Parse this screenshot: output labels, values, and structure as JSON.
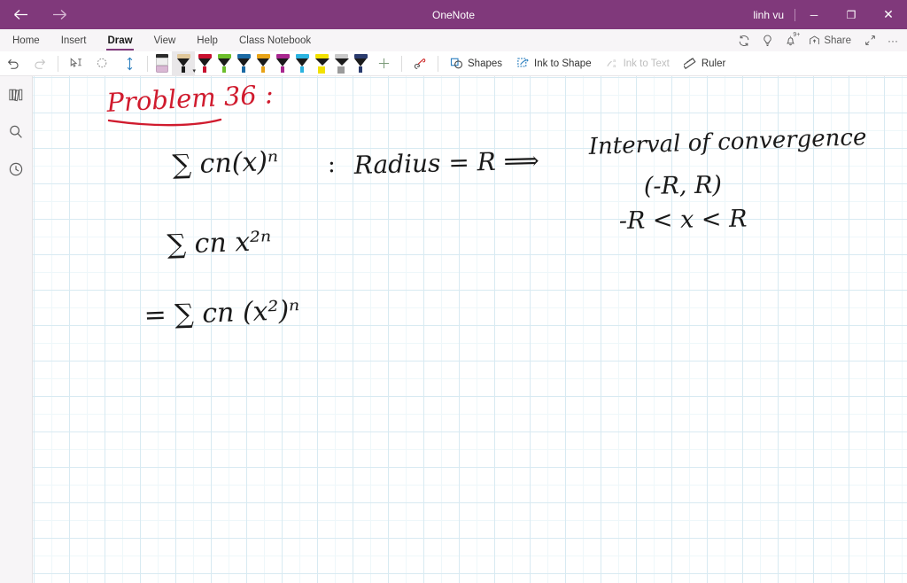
{
  "titlebar": {
    "app_title": "OneNote",
    "user": "linh vu",
    "back_icon": "back-arrow-icon",
    "forward_icon": "forward-arrow-icon",
    "minimize_label": "─",
    "restore_label": "❐",
    "close_label": "✕",
    "accent_color": "#80397B"
  },
  "ribbon": {
    "tabs": [
      {
        "label": "Home",
        "active": false
      },
      {
        "label": "Insert",
        "active": false
      },
      {
        "label": "Draw",
        "active": true
      },
      {
        "label": "View",
        "active": false
      },
      {
        "label": "Help",
        "active": false
      },
      {
        "label": "Class Notebook",
        "active": false
      }
    ],
    "right_items": [
      {
        "name": "sync-icon",
        "label": ""
      },
      {
        "name": "lightbulb-icon",
        "label": ""
      },
      {
        "name": "notifications-bell-icon",
        "label": "",
        "badge": "9+"
      },
      {
        "name": "share-icon",
        "label": "Share"
      },
      {
        "name": "expand-icon",
        "label": ""
      },
      {
        "name": "more-options-icon",
        "label": "···"
      }
    ]
  },
  "draw_toolbar": {
    "undo_label": "Undo",
    "redo_label": "Redo",
    "ink_to_text_select_label": "Select ink",
    "lasso_label": "Lasso Select",
    "panning_label": "Panning Hand",
    "eraser_label": "Eraser",
    "add_pen_label": "+",
    "ink_replay_label": "Ink Replay",
    "pens": [
      {
        "name": "pen-black",
        "color": "#1b1b1b",
        "cap": "#e0c79a",
        "type": "pen",
        "selected": true
      },
      {
        "name": "pen-red",
        "color": "#c8102e",
        "cap": "#c8102e",
        "type": "pen",
        "selected": false
      },
      {
        "name": "pen-green",
        "color": "#6cbe2b",
        "cap": "#6cbe2b",
        "type": "pen",
        "selected": false
      },
      {
        "name": "pen-blue",
        "color": "#1a69a4",
        "cap": "#1a69a4",
        "type": "pen",
        "selected": false
      },
      {
        "name": "pen-gold",
        "color": "#e8a317",
        "cap": "#e8a317",
        "type": "pen",
        "selected": false
      },
      {
        "name": "pen-magenta",
        "color": "#a9268f",
        "cap": "#a9268f",
        "type": "pen",
        "selected": false
      },
      {
        "name": "pen-cyan",
        "color": "#2bb3e0",
        "cap": "#2bb3e0",
        "type": "pen",
        "selected": false
      },
      {
        "name": "highlighter-yellow",
        "color": "#f2e100",
        "cap": "#f2e100",
        "type": "highlighter",
        "selected": false
      },
      {
        "name": "highlighter-silver",
        "color": "#9b9b9b",
        "cap": "#c9c9c9",
        "type": "highlighter",
        "selected": false
      },
      {
        "name": "pen-navy",
        "color": "#2a3b6e",
        "cap": "#2a3b6e",
        "type": "pen",
        "selected": false
      }
    ],
    "commands": [
      {
        "name": "shapes-button",
        "label": "Shapes",
        "disabled": false
      },
      {
        "name": "ink-to-shape-button",
        "label": "Ink to Shape",
        "disabled": false
      },
      {
        "name": "ink-to-text-button",
        "label": "Ink to Text",
        "disabled": true
      },
      {
        "name": "ruler-button",
        "label": "Ruler",
        "disabled": false
      }
    ]
  },
  "rail": {
    "items": [
      {
        "name": "notebooks-icon",
        "label": "Notebooks"
      },
      {
        "name": "search-icon",
        "label": "Search"
      },
      {
        "name": "recent-notes-icon",
        "label": "Recent Notes"
      }
    ]
  },
  "page": {
    "ink_notes": {
      "title": "Problem 36 :",
      "title_color": "#d01b2e",
      "line1_sum": "∑ cn(x)ⁿ",
      "line1_colon": ":",
      "line1_radius": "Radius = R ⟹",
      "right_line1": "Interval of convergence",
      "right_line2": "(-R, R)",
      "right_line3": "-R < x < R",
      "line2": "∑ cn x²ⁿ",
      "line3": "= ∑ cn (x²)ⁿ"
    }
  }
}
